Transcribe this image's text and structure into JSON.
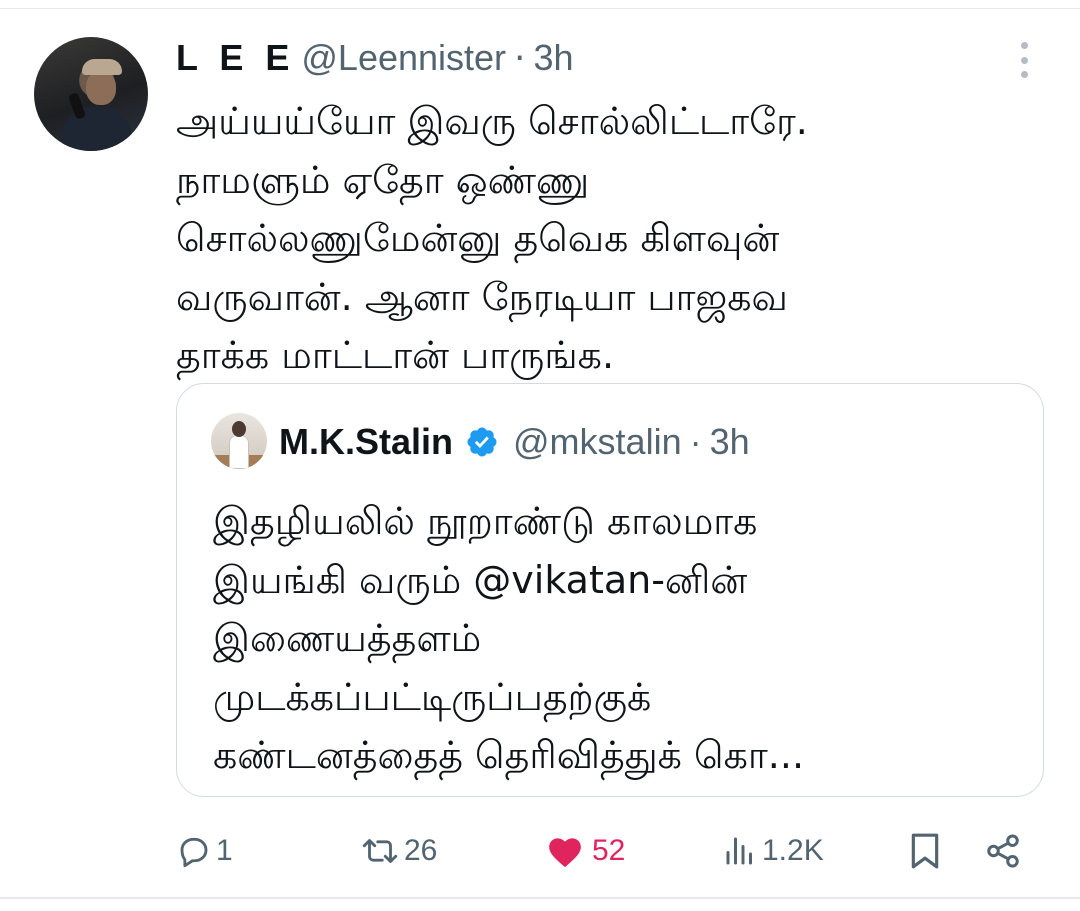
{
  "tweet": {
    "display_name": "L E E",
    "handle": "@Leennister",
    "separator": "·",
    "time": "3h",
    "text_lines": [
      "அய்யய்யோ இவரு சொல்லிட்டாரே.",
      "நாமளும் ஏதோ ஒண்ணு",
      "சொல்லணுமேன்னு தவெக கிளவுன்",
      "வருவான். ஆனா நேரடியா பாஜகவ",
      "தாக்க மாட்டான் பாருங்க."
    ]
  },
  "quote": {
    "display_name": "M.K.Stalin",
    "handle": "@mkstalin",
    "separator": "·",
    "time": "3h",
    "text_lines": [
      "இதழியலில் நூறாண்டு காலமாக",
      "இயங்கி வரும் @vikatan-னின்",
      "இணையத்தளம்",
      "முடக்கப்பட்டிருப்பதற்குக்",
      "கண்டனத்தைத் தெரிவித்துக் கொ..."
    ]
  },
  "actions": {
    "replies": "1",
    "reposts": "26",
    "likes": "52",
    "views": "1.2K"
  },
  "colors": {
    "like": "#e0245e",
    "verified": "#1d9bf0",
    "muted": "#536471"
  },
  "icons": [
    "reply-icon",
    "repost-icon",
    "heart-icon",
    "views-icon",
    "bookmark-icon",
    "share-icon",
    "verified-icon",
    "more-icon"
  ]
}
